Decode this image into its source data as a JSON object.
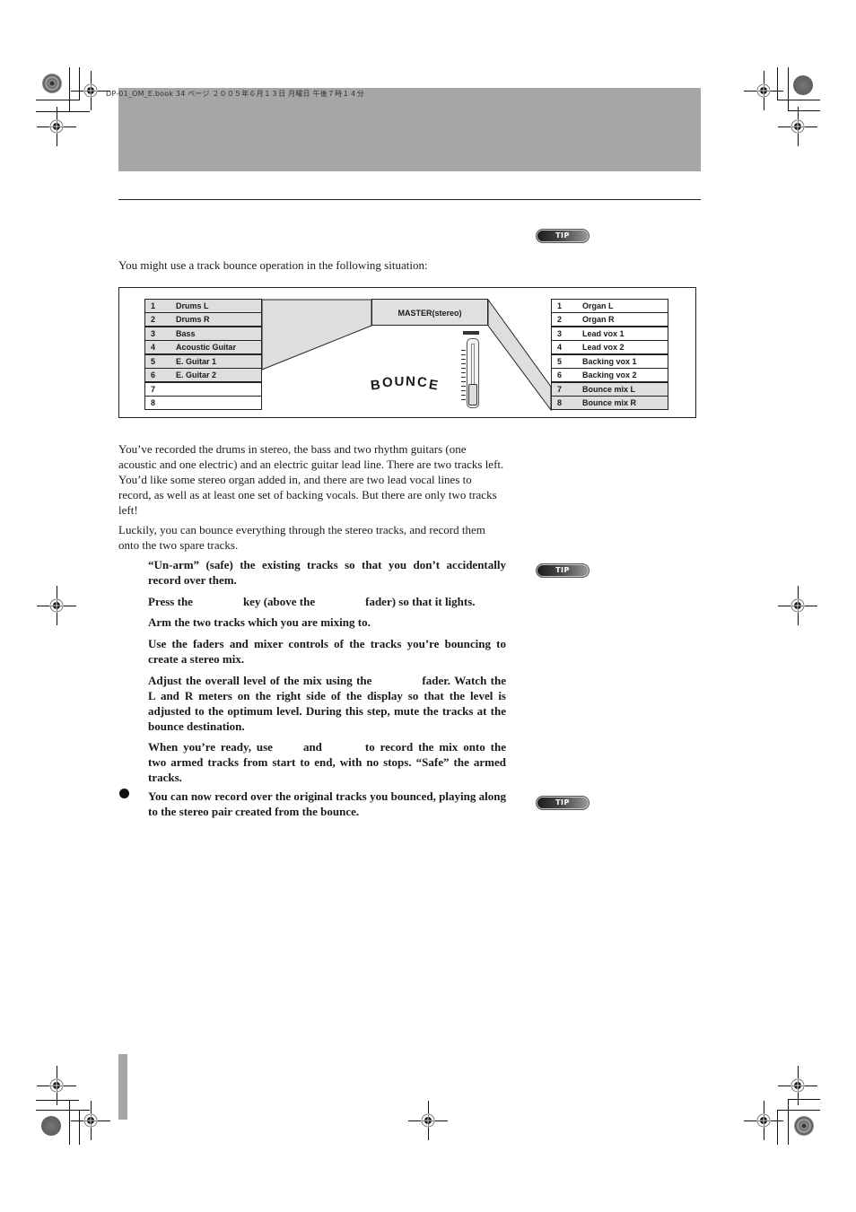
{
  "header": {
    "book_stamp": "DP-01_OM_E.book  34 ページ  ２００５年６月１３日  月曜日  午後７時１４分"
  },
  "tips": [
    "TIP",
    "TIP",
    "TIP"
  ],
  "intro": "You might use a track bounce operation in the following situation:",
  "figure": {
    "master_label": "MASTER(stereo)",
    "bounce_label": "BOUNCE",
    "source_tracks": [
      {
        "num": "1",
        "name": "Drums L",
        "active": true
      },
      {
        "num": "2",
        "name": "Drums R",
        "active": true
      },
      {
        "num": "3",
        "name": "Bass",
        "active": true
      },
      {
        "num": "4",
        "name": "Acoustic Guitar",
        "active": true
      },
      {
        "num": "5",
        "name": "E. Guitar 1",
        "active": true
      },
      {
        "num": "6",
        "name": "E. Guitar 2",
        "active": true
      },
      {
        "num": "7",
        "name": "",
        "active": false
      },
      {
        "num": "8",
        "name": "",
        "active": false
      }
    ],
    "dest_tracks": [
      {
        "num": "1",
        "name": "Organ L",
        "active": false
      },
      {
        "num": "2",
        "name": "Organ R",
        "active": false
      },
      {
        "num": "3",
        "name": "Lead vox 1",
        "active": false
      },
      {
        "num": "4",
        "name": "Lead vox 2",
        "active": false
      },
      {
        "num": "5",
        "name": "Backing vox 1",
        "active": false
      },
      {
        "num": "6",
        "name": "Backing vox 2",
        "active": false
      },
      {
        "num": "7",
        "name": "Bounce mix L",
        "active": true
      },
      {
        "num": "8",
        "name": "Bounce mix R",
        "active": true
      }
    ]
  },
  "paragraphs": [
    "You’ve recorded the drums in stereo, the bass and two rhythm guitars (one acoustic and one electric) and an electric guitar lead line. There are two tracks left. You’d like some stereo organ added in, and there are two lead vocal lines to record, as well as at least one set of backing vocals. But there are only two tracks left!",
    "Luckily, you can bounce everything through the stereo tracks, and record them onto the two spare tracks."
  ],
  "steps": {
    "s1": "“Un-arm” (safe) the existing tracks so that you don’t accidentally record over them.",
    "s2a": "Press the",
    "s2b": "key (above the",
    "s2c": "fader) so that it lights.",
    "s3": "Arm the two tracks which you are mixing to.",
    "s4": "Use the faders and mixer controls of the tracks you’re bouncing to create a stereo mix.",
    "s5a": "Adjust the overall level of the mix using the",
    "s5b": "fader. Watch the L and R meters on the right side of the display so that the level is adjusted to the optimum level. During this step, mute the tracks at the bounce destination.",
    "s6a": "When you’re ready, use",
    "s6b": "and",
    "s6c": "to record the mix onto the two armed tracks from start to end, with no stops. “Safe” the armed tracks.",
    "s7": "You can now record over the original tracks you bounced, playing along to the stereo pair created from the bounce."
  }
}
